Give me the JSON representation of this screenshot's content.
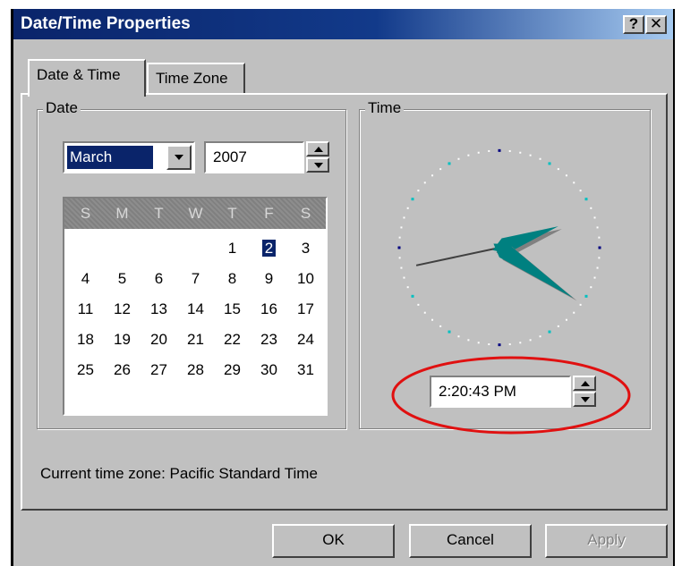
{
  "window": {
    "title": "Date/Time Properties",
    "help_label": "?",
    "close_label": "✕"
  },
  "tabs": [
    {
      "label": "Date & Time",
      "active": true
    },
    {
      "label": "Time Zone",
      "active": false
    }
  ],
  "date_group": {
    "label": "Date",
    "month": "March",
    "year": "2007",
    "calendar": {
      "day_names": [
        "S",
        "M",
        "T",
        "W",
        "T",
        "F",
        "S"
      ],
      "weeks": [
        [
          "",
          "",
          "",
          "",
          "1",
          "2",
          "3"
        ],
        [
          "4",
          "5",
          "6",
          "7",
          "8",
          "9",
          "10"
        ],
        [
          "11",
          "12",
          "13",
          "14",
          "15",
          "16",
          "17"
        ],
        [
          "18",
          "19",
          "20",
          "21",
          "22",
          "23",
          "24"
        ],
        [
          "25",
          "26",
          "27",
          "28",
          "29",
          "30",
          "31"
        ]
      ],
      "selected_day": "2"
    }
  },
  "time_group": {
    "label": "Time",
    "clock": {
      "hour": 2,
      "minute": 20,
      "second": 43
    },
    "time_value": "2:20:43 PM"
  },
  "timezone_text": "Current time zone:  Pacific Standard Time",
  "buttons": {
    "ok": "OK",
    "cancel": "Cancel",
    "apply": "Apply"
  },
  "colors": {
    "title_bar": "#0a246a",
    "face": "#c0c0c0",
    "clock_hand": "#008080",
    "highlight_ring": "#e01010"
  },
  "icons": {
    "dropdown": "chevron-down-icon",
    "spin_up": "arrow-up-icon",
    "spin_down": "arrow-down-icon",
    "help": "help-icon",
    "close": "close-icon"
  }
}
